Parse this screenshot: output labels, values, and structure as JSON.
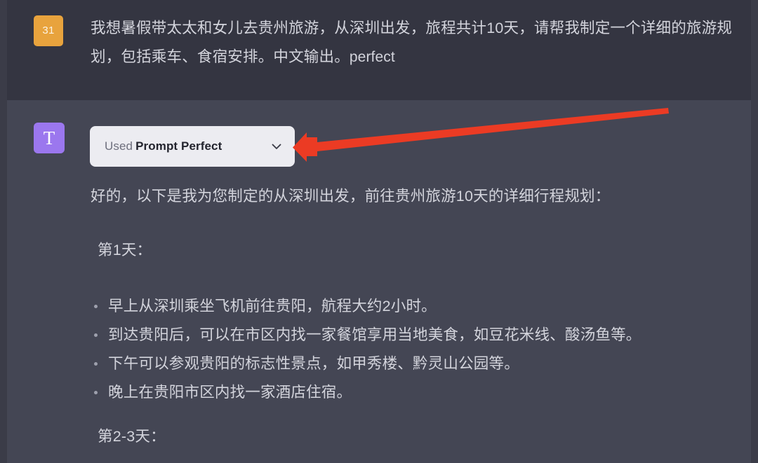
{
  "user_message": {
    "badge": "31",
    "text_cn": "我想暑假带太太和女儿去贵州旅游，从深圳出发，旅程共计10天，请帮我制定一个详细的旅游规划，包括乘车、食宿安排。中文输出。",
    "text_latin": "perfect"
  },
  "assistant": {
    "avatar_glyph": "T",
    "plugin_chip": {
      "prefix": "Used",
      "name": "Prompt Perfect",
      "chevron_icon": "chevron-down-icon"
    },
    "intro": "好的，以下是我为您制定的从深圳出发，前往贵州旅游10天的详细行程规划：",
    "day1_heading": "第1天：",
    "day1_items": [
      "早上从深圳乘坐飞机前往贵阳，航程大约2小时。",
      "到达贵阳后，可以在市区内找一家餐馆享用当地美食，如豆花米线、酸汤鱼等。",
      "下午可以参观贵阳的标志性景点，如甲秀楼、黔灵山公园等。",
      "晚上在贵阳市区内找一家酒店住宿。"
    ],
    "day2_heading": "第2-3天："
  },
  "annotation": {
    "arrow_color": "#eb3b24",
    "arrow_label": "red-pointer-arrow"
  },
  "colors": {
    "user_bg": "#343541",
    "assistant_bg": "#444654",
    "page_gutter": "#3b3c48",
    "badge_bg": "#e8a33d",
    "avatar_bg": "#9b77ee",
    "chip_bg": "#ececf1",
    "text": "#d3d4dc"
  }
}
